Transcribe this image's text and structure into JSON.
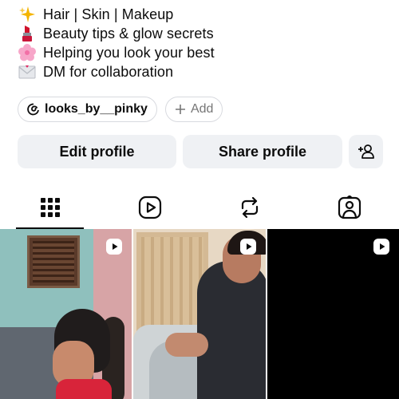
{
  "bio": {
    "lines": [
      {
        "icon": "sparkles-icon",
        "text": "Hair | Skin | Makeup"
      },
      {
        "icon": "lipstick-icon",
        "text": "Beauty tips & glow secrets"
      },
      {
        "icon": "cherry-blossom-icon",
        "text": "Helping you look your best"
      },
      {
        "icon": "envelope-icon",
        "text": "DM for collaboration"
      }
    ]
  },
  "chips": {
    "threads_handle": "looks_by__pinky",
    "add_label": "Add"
  },
  "actions": {
    "edit_label": "Edit profile",
    "share_label": "Share profile"
  },
  "tabs": [
    {
      "name": "posts-grid",
      "icon": "grid-icon",
      "active": true
    },
    {
      "name": "reels",
      "icon": "reels-play-icon",
      "active": false
    },
    {
      "name": "reposts",
      "icon": "repost-icon",
      "active": false
    },
    {
      "name": "tagged",
      "icon": "tagged-person-icon",
      "active": false
    }
  ],
  "grid": {
    "items": [
      {
        "type": "reel",
        "icon": "reel-play-icon"
      },
      {
        "type": "reel",
        "icon": "reel-play-icon"
      },
      {
        "type": "reel",
        "icon": "reel-play-icon"
      }
    ]
  },
  "colors": {
    "button_bg": "#eff1f4",
    "text": "#0c0c0c",
    "chip_border": "#d8dadf"
  }
}
